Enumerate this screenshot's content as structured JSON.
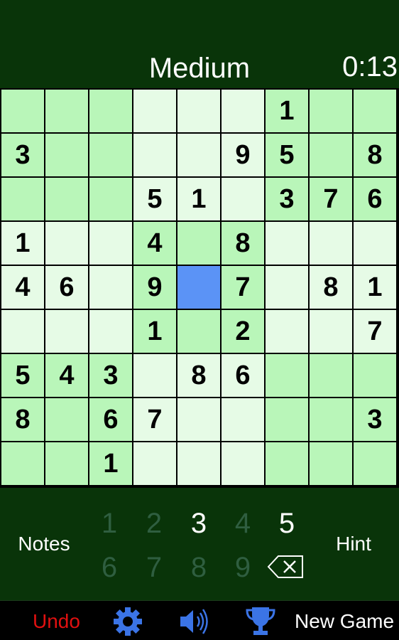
{
  "header": {
    "difficulty": "Medium",
    "timer": "0:13"
  },
  "board": {
    "given": [
      [
        0,
        0,
        0,
        0,
        0,
        0,
        1,
        0,
        0
      ],
      [
        3,
        0,
        0,
        0,
        0,
        9,
        5,
        0,
        8
      ],
      [
        0,
        0,
        0,
        5,
        1,
        0,
        3,
        7,
        6
      ],
      [
        1,
        0,
        0,
        4,
        0,
        8,
        0,
        0,
        0
      ],
      [
        4,
        6,
        0,
        9,
        0,
        7,
        0,
        8,
        1
      ],
      [
        0,
        0,
        0,
        1,
        0,
        2,
        0,
        0,
        7
      ],
      [
        5,
        4,
        3,
        0,
        8,
        6,
        0,
        0,
        0
      ],
      [
        8,
        0,
        6,
        7,
        0,
        0,
        0,
        0,
        3
      ],
      [
        0,
        0,
        1,
        0,
        0,
        0,
        0,
        0,
        0
      ]
    ],
    "selected_cell": {
      "row": 4,
      "col": 4
    }
  },
  "controls": {
    "notes_label": "Notes",
    "hint_label": "Hint",
    "numbers": [
      {
        "value": "1",
        "available": false
      },
      {
        "value": "2",
        "available": false
      },
      {
        "value": "3",
        "available": true
      },
      {
        "value": "4",
        "available": false
      },
      {
        "value": "5",
        "available": true
      },
      {
        "value": "6",
        "available": false
      },
      {
        "value": "7",
        "available": false
      },
      {
        "value": "8",
        "available": false
      },
      {
        "value": "9",
        "available": false
      }
    ],
    "erase_icon": "backspace-icon"
  },
  "toolbar": {
    "undo_label": "Undo",
    "settings_icon": "gear-icon",
    "sound_icon": "speaker-icon",
    "stats_icon": "trophy-icon",
    "new_game_label": "New Game"
  },
  "colors": {
    "background": "#093409",
    "cell_light": "#e6fbe6",
    "cell_dark": "#b9f6b9",
    "cell_selected": "#5b93f6",
    "undo": "#e01010",
    "icon_blue": "#3b74e6"
  }
}
